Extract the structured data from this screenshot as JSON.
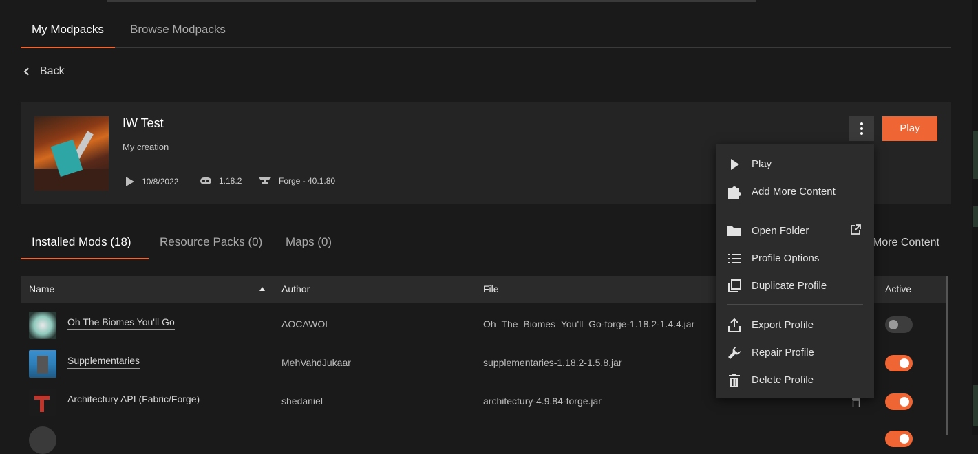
{
  "tabs_top": [
    "My Modpacks",
    "Browse Modpacks"
  ],
  "back_label": "Back",
  "profile": {
    "name": "IW Test",
    "subtitle": "My creation",
    "date": "10/8/2022",
    "version": "1.18.2",
    "loader": "Forge - 40.1.80",
    "play_label": "Play"
  },
  "content_tabs": [
    "Installed Mods (18)",
    "Resource Packs (0)",
    "Maps (0)"
  ],
  "more_content_label": "More Content",
  "table": {
    "headers": {
      "name": "Name",
      "author": "Author",
      "file": "File",
      "active": "Active"
    },
    "rows": [
      {
        "name": "Oh The Biomes You'll Go",
        "author": "AOCAWOL",
        "file": "Oh_The_Biomes_You'll_Go-forge-1.18.2-1.4.4.jar",
        "active": false,
        "icon_color": "#5fb2a6"
      },
      {
        "name": "Supplementaries",
        "author": "MehVahdJukaar",
        "file": "supplementaries-1.18.2-1.5.8.jar",
        "active": true,
        "icon_color": "#2e7fb8"
      },
      {
        "name": "Architectury API (Fabric/Forge)",
        "author": "shedaniel",
        "file": "architectury-4.9.84-forge.jar",
        "active": true,
        "icon_color": "#c0362c"
      }
    ]
  },
  "menu": {
    "items": [
      {
        "label": "Play",
        "icon": "play-icon"
      },
      {
        "label": "Add More Content",
        "icon": "puzzle-icon"
      },
      {
        "label": "Open Folder",
        "icon": "folder-icon"
      },
      {
        "label": "Profile Options",
        "icon": "list-icon"
      },
      {
        "label": "Duplicate Profile",
        "icon": "duplicate-icon"
      },
      {
        "label": "Export Profile",
        "icon": "export-icon"
      },
      {
        "label": "Repair Profile",
        "icon": "wrench-icon"
      },
      {
        "label": "Delete Profile",
        "icon": "trash-icon"
      }
    ]
  },
  "colors": {
    "accent": "#f06534",
    "background": "#1a1a1a",
    "card": "#242424",
    "menu": "#2c2c2c"
  }
}
